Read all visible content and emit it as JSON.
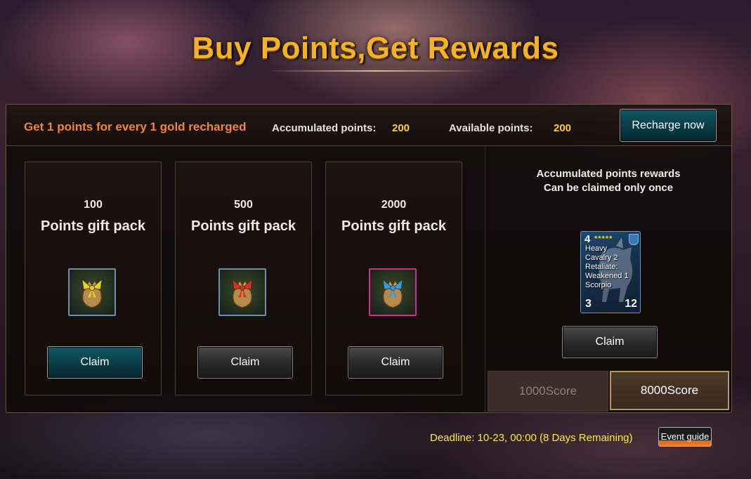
{
  "title": "Buy Points,Get Rewards",
  "header": {
    "rule_text": "Get 1 points for every 1 gold recharged",
    "accumulated_label": "Accumulated points:",
    "accumulated_value": "200",
    "available_label": "Available points:",
    "available_value": "200",
    "recharge_label": "Recharge now"
  },
  "packs": [
    {
      "amount": "100",
      "name": "Points gift pack",
      "ribbon_color": "#e6d21a",
      "frame_color": "#6f8fb0",
      "claim_label": "Claim",
      "claim_style": "teal",
      "icon": "gift-bag-icon"
    },
    {
      "amount": "500",
      "name": "Points gift pack",
      "ribbon_color": "#d8321e",
      "frame_color": "#6f8fb0",
      "claim_label": "Claim",
      "claim_style": "dark",
      "icon": "gift-bag-icon"
    },
    {
      "amount": "2000",
      "name": "Points gift pack",
      "ribbon_color": "#2a9ee8",
      "frame_color": "#d0308c",
      "claim_label": "Claim",
      "claim_style": "dark",
      "icon": "gift-bag-icon"
    }
  ],
  "rewards": {
    "title_line1": "Accumulated points rewards",
    "title_line2": "Can be claimed only once",
    "card": {
      "cost": "4",
      "desc_lines": [
        "Heavy",
        "Cavalry 2",
        "Retaliate:",
        "Weakened 1",
        "Scorpio"
      ],
      "attack": "3",
      "health": "12"
    },
    "claim_label": "Claim",
    "tabs": [
      {
        "label": "1000Score",
        "selected": false
      },
      {
        "label": "8000Score",
        "selected": true
      }
    ]
  },
  "footer": {
    "deadline": "Deadline: 10-23, 00:00 (8 Days Remaining)",
    "guide_label": "Event guide"
  }
}
